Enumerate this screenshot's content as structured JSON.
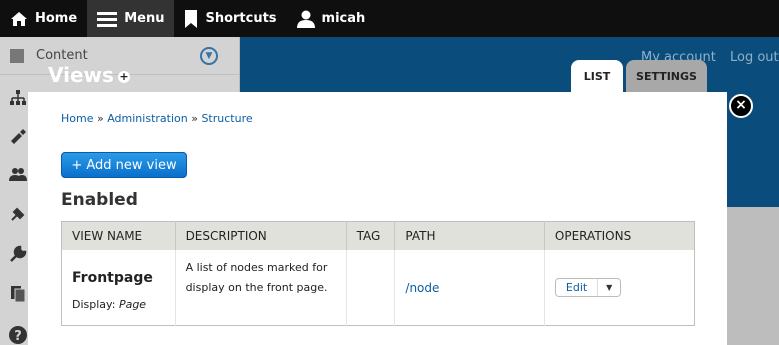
{
  "toolbar": {
    "home": "Home",
    "menu": "Menu",
    "shortcuts": "Shortcuts",
    "user": "micah"
  },
  "tray": {
    "first_item": "Content"
  },
  "background": {
    "my_account": "My account",
    "logout": "Log out"
  },
  "overlay": {
    "title": "Views",
    "tabs": [
      "LIST",
      "SETTINGS"
    ],
    "close_symbol": "×"
  },
  "breadcrumb": {
    "items": [
      "Home",
      "Administration",
      "Structure"
    ],
    "separator": "»"
  },
  "add_button": "+ Add new view",
  "section_title": "Enabled",
  "table": {
    "headers": [
      "VIEW NAME",
      "DESCRIPTION",
      "TAG",
      "PATH",
      "OPERATIONS"
    ],
    "rows": [
      {
        "name": "Frontpage",
        "display_label": "Display:",
        "display_value": "Page",
        "description": "A list of nodes marked for display on the front page.",
        "tag": "",
        "path": "/node",
        "operation": "Edit"
      }
    ]
  },
  "colors": {
    "link": "#0a5fa5",
    "button": "#1584dc",
    "toolbar": "#0f0f0f"
  }
}
